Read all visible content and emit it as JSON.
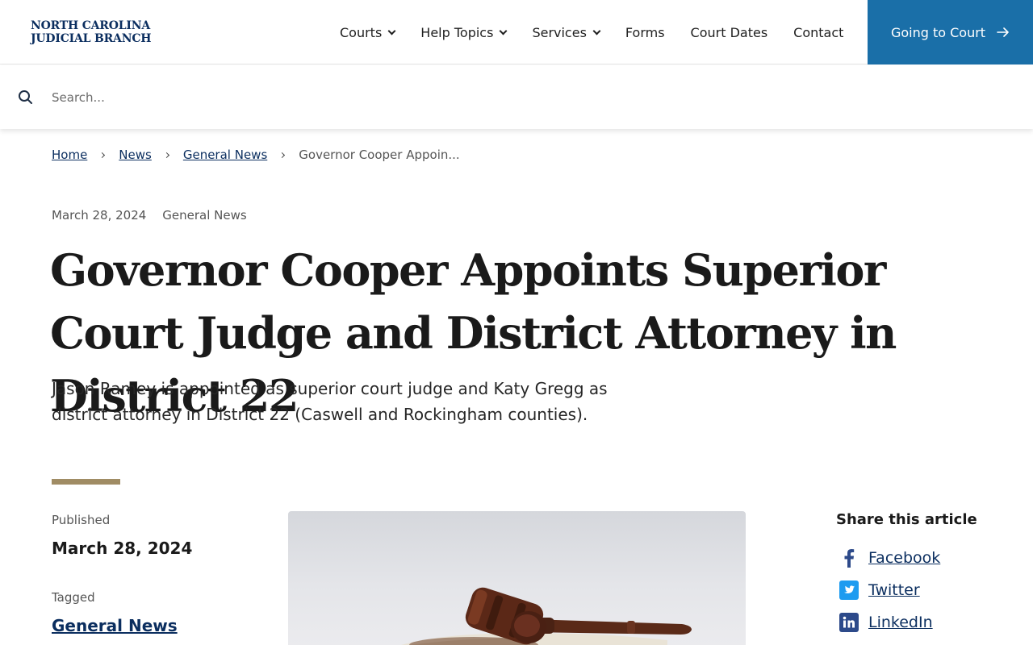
{
  "header": {
    "logo_line1": "NORTH CAROLINA",
    "logo_line2": "JUDICIAL BRANCH",
    "nav": [
      {
        "label": "Courts",
        "has_dropdown": true
      },
      {
        "label": "Help Topics",
        "has_dropdown": true
      },
      {
        "label": "Services",
        "has_dropdown": true
      },
      {
        "label": "Forms",
        "has_dropdown": false
      },
      {
        "label": "Court Dates",
        "has_dropdown": false
      },
      {
        "label": "Contact",
        "has_dropdown": false
      }
    ],
    "cta_label": "Going to Court",
    "cta_color": "#1a6fa8"
  },
  "search": {
    "placeholder": "Search...",
    "icon": "search-icon"
  },
  "breadcrumb": {
    "home": "Home",
    "news": "News",
    "general_news": "General News",
    "current": "Governor Cooper Appoin..."
  },
  "article": {
    "meta_date": "March 28, 2024",
    "meta_category": "General News",
    "title": "Governor Cooper Appoints Superior Court Judge and District Attorney in District 22",
    "lede": "Jason Ramey is appointed as superior court judge and Katy Gregg as district attorney in District 22 (Caswell and Rockingham counties).",
    "accent_color": "#a08c64"
  },
  "sidebar": {
    "published_label": "Published",
    "published_date": "March 28, 2024",
    "tagged_label": "Tagged",
    "tag": "General News"
  },
  "share": {
    "title": "Share this article",
    "facebook": "Facebook",
    "twitter": "Twitter",
    "linkedin": "LinkedIn"
  }
}
